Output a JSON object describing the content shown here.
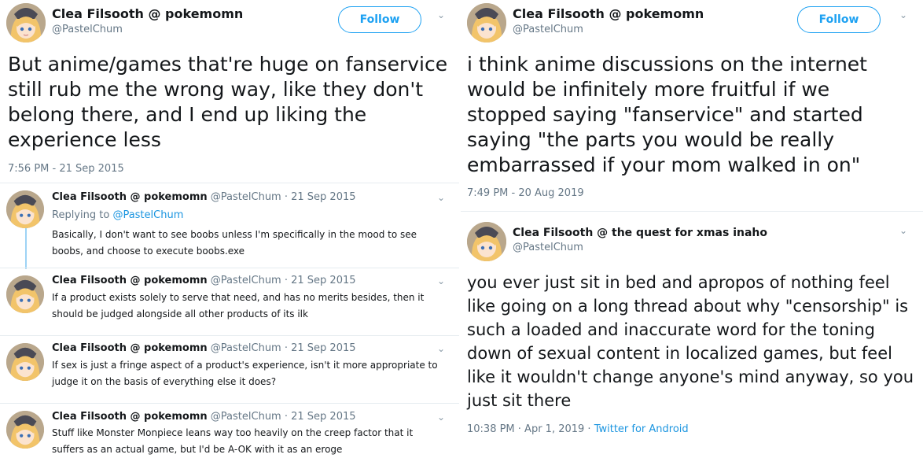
{
  "left": {
    "main": {
      "name": "Clea Filsooth @ pokemomn",
      "handle": "@PastelChum",
      "follow_label": "Follow",
      "text": "But anime/games that're huge on fanservice still rub me the wrong way, like they don't belong there, and I end up liking the experience less",
      "timestamp": "7:56 PM - 21 Sep 2015"
    },
    "replies": [
      {
        "name": "Clea Filsooth @ pokemomn",
        "handle": "@PastelChum",
        "date": "· 21 Sep 2015",
        "replying_prefix": "Replying to ",
        "replying_to": "@PastelChum",
        "text": "Basically, I don't want to see boobs unless I'm specifically in the mood to see boobs, and choose to execute boobs.exe"
      },
      {
        "name": "Clea Filsooth @ pokemomn",
        "handle": "@PastelChum",
        "date": "· 21 Sep 2015",
        "text": "If a product exists solely to serve that need, and has no merits besides, then it should be judged alongside all other products of its ilk"
      },
      {
        "name": "Clea Filsooth @ pokemomn",
        "handle": "@PastelChum",
        "date": "· 21 Sep 2015",
        "text": "If sex is just a fringe aspect of a product's experience, isn't it more appropriate to judge it on the basis of everything else it does?"
      },
      {
        "name": "Clea Filsooth @ pokemomn",
        "handle": "@PastelChum",
        "date": "· 21 Sep 2015",
        "text": "Stuff like Monster Monpiece leans way too heavily on the creep factor that it suffers as an actual game, but I'd be A-OK with it as an eroge"
      }
    ]
  },
  "right": {
    "top": {
      "name": "Clea Filsooth @ pokemomn",
      "handle": "@PastelChum",
      "follow_label": "Follow",
      "text": "i think anime discussions on the internet would be infinitely more fruitful if we stopped saying \"fanservice\" and started saying \"the parts you would be really embarrassed if your mom walked in on\"",
      "timestamp": "7:49 PM - 20 Aug 2019"
    },
    "bottom": {
      "name": "Clea Filsooth @ the quest for xmas inaho",
      "handle": "@PastelChum",
      "text": "you ever just sit in bed and apropos of nothing feel like going on a long thread about why \"censorship\" is such a loaded and inaccurate word for the toning down of sexual content in localized games, but feel like it wouldn't change anyone's mind anyway, so you just sit there",
      "timestamp": "10:38 PM · Apr 1, 2019 · ",
      "source": "Twitter for Android"
    }
  },
  "icons": {
    "chevron": "chevron-down-icon",
    "avatar": "anime-avatar"
  },
  "colors": {
    "accent": "#1da1f2",
    "link": "#1b95e0",
    "muted": "#657786",
    "thread": "#9ed3f5"
  }
}
